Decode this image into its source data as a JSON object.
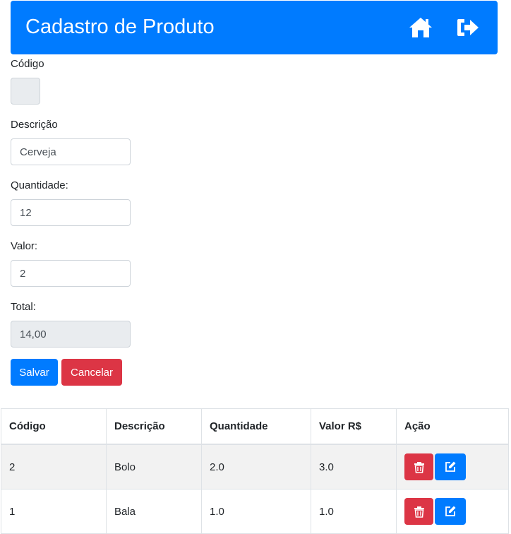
{
  "header": {
    "title": "Cadastro de Produto",
    "home_icon": "home-icon",
    "logout_icon": "sign-out-icon"
  },
  "form": {
    "codigo": {
      "label": "Código",
      "value": ""
    },
    "descricao": {
      "label": "Descrição",
      "value": "Cerveja"
    },
    "quantidade": {
      "label": "Quantidade:",
      "value": "12"
    },
    "valor": {
      "label": "Valor:",
      "value": "2"
    },
    "total": {
      "label": "Total:",
      "value": "14,00"
    }
  },
  "buttons": {
    "save": "Salvar",
    "cancel": "Cancelar"
  },
  "table": {
    "headers": [
      "Código",
      "Descrição",
      "Quantidade",
      "Valor R$",
      "Ação"
    ],
    "rows": [
      [
        "2",
        "Bolo",
        "2.0",
        "3.0"
      ],
      [
        "1",
        "Bala",
        "1.0",
        "1.0"
      ]
    ],
    "row_action_icons": [
      "trash-icon",
      "edit-icon"
    ]
  },
  "colors": {
    "primary": "#007bff",
    "danger": "#dc3545"
  }
}
